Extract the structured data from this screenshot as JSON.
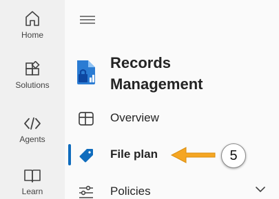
{
  "rail": {
    "items": [
      {
        "label": "Home",
        "icon": "home-icon"
      },
      {
        "label": "Solutions",
        "icon": "apps-add-icon"
      },
      {
        "label": "Agents",
        "icon": "code-icon"
      },
      {
        "label": "Learn",
        "icon": "book-icon"
      }
    ]
  },
  "app": {
    "title_line1": "Records",
    "title_line2": "Management",
    "icon": "records-management-icon"
  },
  "nav": {
    "items": [
      {
        "label": "Overview",
        "icon": "table-icon",
        "selected": false
      },
      {
        "label": "File plan",
        "icon": "tag-icon",
        "selected": true
      },
      {
        "label": "Policies",
        "icon": "sliders-icon",
        "selected": false,
        "expandable": true
      }
    ]
  },
  "callout": {
    "step": "5",
    "arrow_color": "#f5a623"
  },
  "colors": {
    "accent": "#0f6cbd",
    "rail_background": "#f0f0f0",
    "nav_background": "#fafafa"
  }
}
